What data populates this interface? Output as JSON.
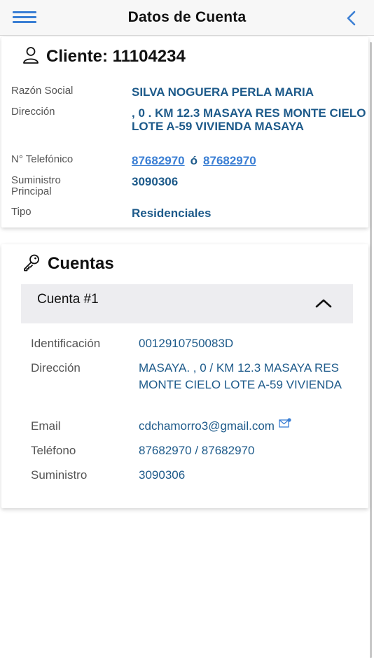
{
  "header": {
    "title": "Datos de Cuenta",
    "menu_icon": "hamburger-menu-icon",
    "back_icon": "chevron-left-icon",
    "accent": "#3b7fd4"
  },
  "client": {
    "title": "Cliente: 11104234",
    "fields": {
      "razon_social": {
        "label": "Razón Social",
        "value": "SILVA NOGUERA PERLA MARIA"
      },
      "direccion": {
        "label": "Dirección",
        "value": ", 0 . KM 12.3 MASAYA RES MONTE CIELO LOTE A-59 VIVIENDA MASAYA"
      },
      "telefono": {
        "label": "N° Telefónico",
        "phone1": "87682970",
        "separator": "ó",
        "phone2": "87682970"
      },
      "suministro": {
        "label": "Suministro Principal",
        "value": "3090306"
      },
      "tipo": {
        "label": "Tipo",
        "value": "Residenciales"
      }
    }
  },
  "accounts": {
    "title": "Cuentas",
    "items": [
      {
        "header": "Cuenta #1",
        "expanded": true,
        "fields": {
          "identificacion": {
            "label": "Identificación",
            "value": "0012910750083D"
          },
          "direccion": {
            "label": "Dirección",
            "value": "MASAYA. , 0 / KM 12.3 MASAYA RES MONTE CIELO LOTE A-59 VIVIENDA"
          },
          "email": {
            "label": "Email",
            "value": "cdchamorro3@gmail.com"
          },
          "telefono": {
            "label": "Teléfono",
            "value": "87682970 / 87682970"
          },
          "suministro": {
            "label": "Suministro",
            "value": "3090306"
          }
        }
      }
    ]
  }
}
